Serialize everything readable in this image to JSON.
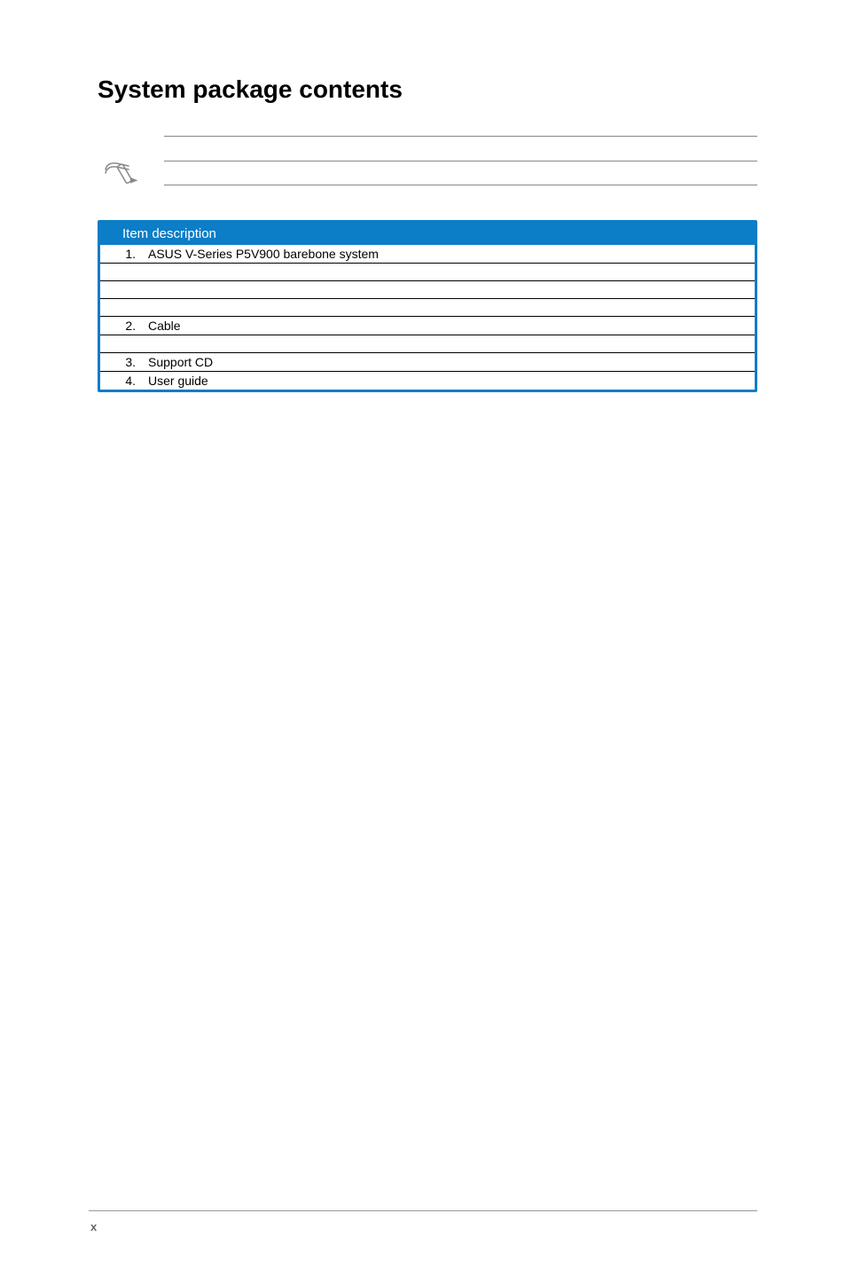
{
  "title": "System package contents",
  "table": {
    "header": "Item description",
    "rows": [
      {
        "num": "1.",
        "desc": "ASUS V-Series P5V900 barebone system"
      },
      {
        "num": "",
        "desc": ""
      },
      {
        "num": "",
        "desc": ""
      },
      {
        "num": "",
        "desc": ""
      },
      {
        "num": "2.",
        "desc": "Cable"
      },
      {
        "num": "",
        "desc": ""
      },
      {
        "num": "3.",
        "desc": "Support CD"
      },
      {
        "num": "4.",
        "desc": "User guide"
      }
    ]
  },
  "footer": {
    "page": "x"
  }
}
